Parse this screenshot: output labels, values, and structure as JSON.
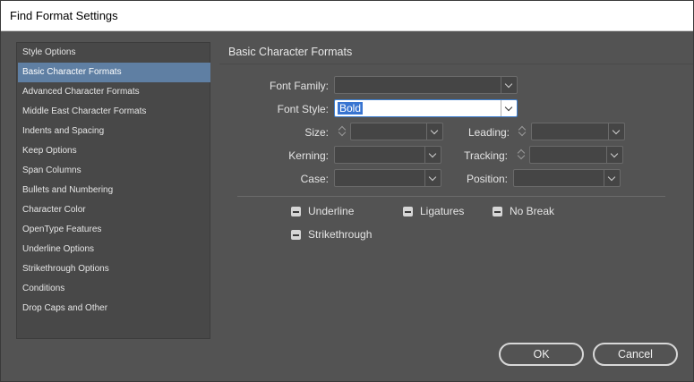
{
  "window": {
    "title": "Find Format Settings"
  },
  "sidebar": {
    "items": [
      {
        "label": "Style Options"
      },
      {
        "label": "Basic Character Formats",
        "selected": true
      },
      {
        "label": "Advanced Character Formats"
      },
      {
        "label": "Middle East Character Formats"
      },
      {
        "label": "Indents and Spacing"
      },
      {
        "label": "Keep Options"
      },
      {
        "label": "Span Columns"
      },
      {
        "label": "Bullets and Numbering"
      },
      {
        "label": "Character Color"
      },
      {
        "label": "OpenType Features"
      },
      {
        "label": "Underline Options"
      },
      {
        "label": "Strikethrough Options"
      },
      {
        "label": "Conditions"
      },
      {
        "label": "Drop Caps and Other"
      }
    ]
  },
  "panel": {
    "title": "Basic Character Formats",
    "font_family": {
      "label": "Font Family:",
      "value": ""
    },
    "font_style": {
      "label": "Font Style:",
      "value": "Bold"
    },
    "size": {
      "label": "Size:",
      "value": ""
    },
    "leading": {
      "label": "Leading:",
      "value": ""
    },
    "kerning": {
      "label": "Kerning:",
      "value": ""
    },
    "tracking": {
      "label": "Tracking:",
      "value": ""
    },
    "case": {
      "label": "Case:",
      "value": ""
    },
    "position": {
      "label": "Position:",
      "value": ""
    },
    "checkboxes": {
      "underline": "Underline",
      "ligatures": "Ligatures",
      "no_break": "No Break",
      "strikethrough": "Strikethrough"
    }
  },
  "buttons": {
    "ok": "OK",
    "cancel": "Cancel"
  },
  "colors": {
    "selection": "#5f7fa3",
    "highlight": "#3874d1",
    "background": "#535353"
  }
}
